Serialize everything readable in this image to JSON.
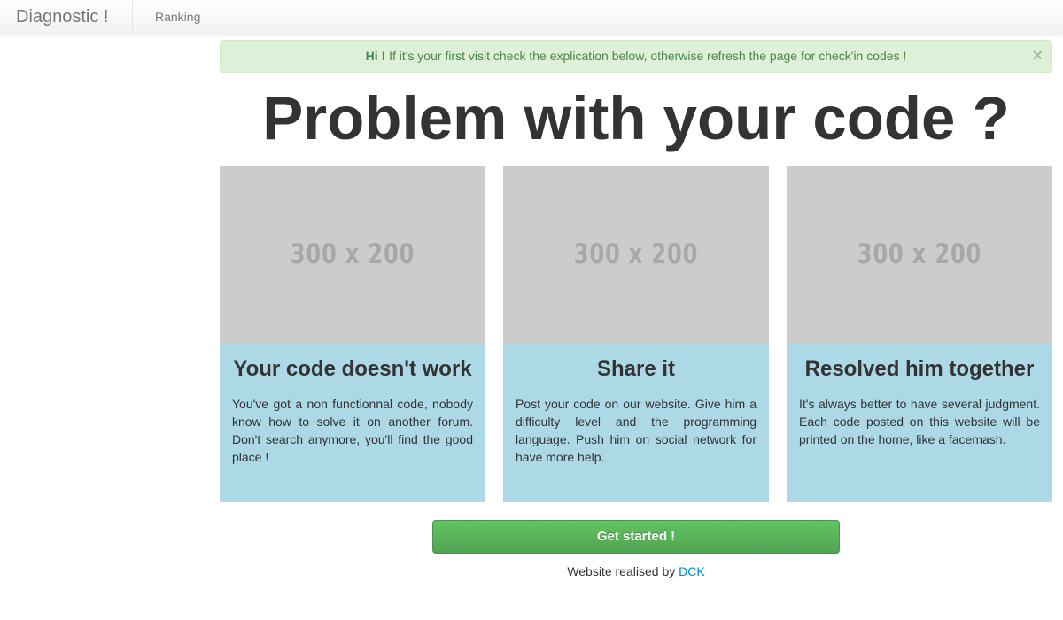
{
  "navbar": {
    "brand": "Diagnostic !",
    "links": [
      {
        "label": "Ranking"
      }
    ]
  },
  "alert": {
    "strong": "Hi !",
    "message": " If it's your first visit check the explication below, otherwise refresh the page for check'in codes !",
    "close": "×"
  },
  "headline": "Problem with your code ?",
  "cards": [
    {
      "placeholder": "300 x 200",
      "title": "Your code doesn't work",
      "text": "You've got a non functionnal code, nobody know how to solve it on another forum. Don't search anymore, you'll find the good place !"
    },
    {
      "placeholder": "300 x 200",
      "title": "Share it",
      "text": "Post your code on our website. Give him a difficulty level and the programming language. Push him on social network for have more help."
    },
    {
      "placeholder": "300 x 200",
      "title": "Resolved him together",
      "text": "It's always better to have several judgment. Each code posted on this website will be printed on the home, like a facemash."
    }
  ],
  "cta": {
    "label": "Get started !"
  },
  "footer": {
    "text": "Website realised by ",
    "link": "DCK"
  },
  "colors": {
    "alert_bg": "#dff0d8",
    "alert_text": "#468847",
    "card_bg": "#add8e6",
    "placeholder_bg": "#cccccc",
    "button_green": "#5bb75b",
    "link": "#0088cc"
  }
}
